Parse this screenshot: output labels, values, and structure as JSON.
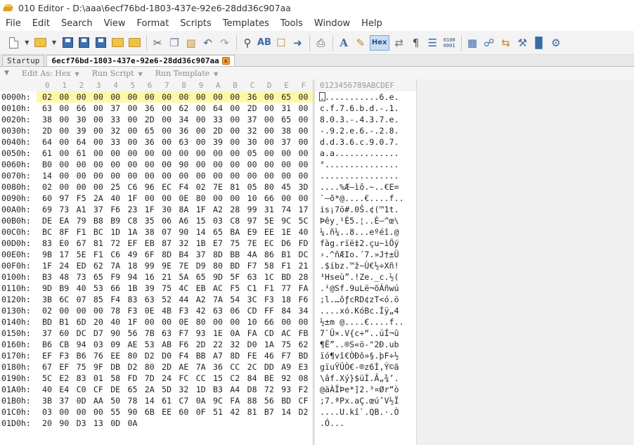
{
  "window": {
    "title": "010 Editor - D:\\aaa\\6ecf76bd-1803-437e-92e6-28dd36c907aa"
  },
  "menu": [
    "File",
    "Edit",
    "Search",
    "View",
    "Format",
    "Scripts",
    "Templates",
    "Tools",
    "Window",
    "Help"
  ],
  "toolbar": {
    "hex_label": "Hex",
    "bits_label_top": "0100",
    "bits_label_bottom": "0001"
  },
  "tabs": [
    {
      "label": "Startup",
      "active": false
    },
    {
      "label": "6ecf76bd-1803-437e-92e6-28dd36c907aa",
      "active": true,
      "close": "x"
    }
  ],
  "subbar": {
    "edit_as": "Edit As: Hex",
    "run_script": "Run Script",
    "run_template": "Run Template"
  },
  "columns": {
    "hex": [
      "0",
      "1",
      "2",
      "3",
      "4",
      "5",
      "6",
      "7",
      "8",
      "9",
      "A",
      "B",
      "C",
      "D",
      "E",
      "F"
    ],
    "ascii": "0123456789ABCDEF"
  },
  "rows": [
    {
      "addr": "0000h:",
      "hex": [
        "02",
        "00",
        "00",
        "00",
        "00",
        "00",
        "00",
        "00",
        "00",
        "00",
        "00",
        "00",
        "36",
        "00",
        "65",
        "00"
      ],
      "ascii": "............6.e."
    },
    {
      "addr": "0010h:",
      "hex": [
        "63",
        "00",
        "66",
        "00",
        "37",
        "00",
        "36",
        "00",
        "62",
        "00",
        "64",
        "00",
        "2D",
        "00",
        "31",
        "00"
      ],
      "ascii": "c.f.7.6.b.d.-.1."
    },
    {
      "addr": "0020h:",
      "hex": [
        "38",
        "00",
        "30",
        "00",
        "33",
        "00",
        "2D",
        "00",
        "34",
        "00",
        "33",
        "00",
        "37",
        "00",
        "65",
        "00"
      ],
      "ascii": "8.0.3.-.4.3.7.e."
    },
    {
      "addr": "0030h:",
      "hex": [
        "2D",
        "00",
        "39",
        "00",
        "32",
        "00",
        "65",
        "00",
        "36",
        "00",
        "2D",
        "00",
        "32",
        "00",
        "38",
        "00"
      ],
      "ascii": "-.9.2.e.6.-.2.8."
    },
    {
      "addr": "0040h:",
      "hex": [
        "64",
        "00",
        "64",
        "00",
        "33",
        "00",
        "36",
        "00",
        "63",
        "00",
        "39",
        "00",
        "30",
        "00",
        "37",
        "00"
      ],
      "ascii": "d.d.3.6.c.9.0.7."
    },
    {
      "addr": "0050h:",
      "hex": [
        "61",
        "00",
        "61",
        "00",
        "00",
        "00",
        "00",
        "00",
        "00",
        "00",
        "00",
        "00",
        "05",
        "00",
        "00",
        "00"
      ],
      "ascii": "a.a............."
    },
    {
      "addr": "0060h:",
      "hex": [
        "B0",
        "00",
        "00",
        "00",
        "00",
        "00",
        "00",
        "00",
        "90",
        "00",
        "00",
        "00",
        "00",
        "00",
        "00",
        "00"
      ],
      "ascii": "°..............."
    },
    {
      "addr": "0070h:",
      "hex": [
        "14",
        "00",
        "00",
        "00",
        "00",
        "00",
        "00",
        "00",
        "00",
        "00",
        "00",
        "00",
        "00",
        "00",
        "00",
        "00"
      ],
      "ascii": "................"
    },
    {
      "addr": "0080h:",
      "hex": [
        "02",
        "00",
        "00",
        "00",
        "25",
        "C6",
        "96",
        "EC",
        "F4",
        "02",
        "7E",
        "81",
        "05",
        "80",
        "45",
        "3D"
      ],
      "ascii": "....%Æ–ìô.~..€E="
    },
    {
      "addr": "0090h:",
      "hex": [
        "60",
        "97",
        "F5",
        "2A",
        "40",
        "1F",
        "00",
        "00",
        "0E",
        "80",
        "00",
        "00",
        "10",
        "66",
        "00",
        "00"
      ],
      "ascii": "`—õ*@....€....f.."
    },
    {
      "addr": "00A0h:",
      "hex": [
        "69",
        "73",
        "A1",
        "37",
        "F6",
        "23",
        "1F",
        "30",
        "8A",
        "1F",
        "A2",
        "28",
        "99",
        "31",
        "74",
        "17"
      ],
      "ascii": "is¡7ö#.0Š.¢(™1t."
    },
    {
      "addr": "00B0h:",
      "hex": [
        "DE",
        "EA",
        "79",
        "B8",
        "B9",
        "C8",
        "35",
        "06",
        "A6",
        "15",
        "03",
        "C8",
        "97",
        "5E",
        "9C",
        "5C"
      ],
      "ascii": "Þêy¸¹È5.¦..È—^œ\\"
    },
    {
      "addr": "00C0h:",
      "hex": [
        "BC",
        "8F",
        "F1",
        "BC",
        "1D",
        "1A",
        "38",
        "07",
        "90",
        "14",
        "65",
        "BA",
        "E9",
        "EE",
        "1E",
        "40"
      ],
      "ascii": "¼.ñ¼..8...eºéî.@"
    },
    {
      "addr": "00D0h:",
      "hex": [
        "83",
        "E0",
        "67",
        "81",
        "72",
        "EF",
        "EB",
        "87",
        "32",
        "1B",
        "E7",
        "75",
        "7E",
        "EC",
        "D6",
        "FD"
      ],
      "ascii": "fàg.rïë‡2.çu~ìÖý"
    },
    {
      "addr": "00E0h:",
      "hex": [
        "9B",
        "17",
        "5E",
        "F1",
        "C6",
        "49",
        "6F",
        "8D",
        "B4",
        "37",
        "8D",
        "BB",
        "4A",
        "86",
        "B1",
        "DC"
      ],
      "ascii": "›.^ñÆIo.´7.»J†±Ü"
    },
    {
      "addr": "00F0h:",
      "hex": [
        "1F",
        "24",
        "ED",
        "62",
        "7A",
        "18",
        "99",
        "9E",
        "7E",
        "D9",
        "80",
        "BD",
        "F7",
        "58",
        "F1",
        "21"
      ],
      "ascii": ".$íbz.™ž~Ù€½÷Xñ!"
    },
    {
      "addr": "0100h:",
      "hex": [
        "B3",
        "48",
        "73",
        "65",
        "F9",
        "94",
        "16",
        "21",
        "5A",
        "65",
        "9D",
        "5F",
        "63",
        "1C",
        "BD",
        "28"
      ],
      "ascii": "³Hseù”.!Ze._c.½("
    },
    {
      "addr": "0110h:",
      "hex": [
        "9D",
        "B9",
        "40",
        "53",
        "66",
        "1B",
        "39",
        "75",
        "4C",
        "EB",
        "AC",
        "F5",
        "C1",
        "F1",
        "77",
        "FA"
      ],
      "ascii": ".¹@Sf.9uLë¬õÁñwú"
    },
    {
      "addr": "0120h:",
      "hex": [
        "3B",
        "6C",
        "07",
        "85",
        "F4",
        "83",
        "63",
        "52",
        "44",
        "A2",
        "7A",
        "54",
        "3C",
        "F3",
        "18",
        "F6"
      ],
      "ascii": ";l.…ôƒcRD¢zT<ó.ö"
    },
    {
      "addr": "0130h:",
      "hex": [
        "02",
        "00",
        "00",
        "00",
        "78",
        "F3",
        "0E",
        "4B",
        "F3",
        "42",
        "63",
        "06",
        "CD",
        "FF",
        "84",
        "34"
      ],
      "ascii": "....xó.KóBc.Íÿ„4"
    },
    {
      "addr": "0140h:",
      "hex": [
        "BD",
        "B1",
        "6D",
        "20",
        "40",
        "1F",
        "00",
        "00",
        "0E",
        "80",
        "00",
        "00",
        "10",
        "66",
        "00",
        "00"
      ],
      "ascii": "½±m @....€....f.."
    },
    {
      "addr": "0150h:",
      "hex": [
        "37",
        "60",
        "DC",
        "D7",
        "90",
        "56",
        "7B",
        "63",
        "F7",
        "93",
        "1E",
        "0A",
        "FA",
        "CD",
        "AC",
        "FB"
      ],
      "ascii": "7`Ü×.V{c÷“..úÍ¬û"
    },
    {
      "addr": "0160h:",
      "hex": [
        "B6",
        "CB",
        "94",
        "03",
        "09",
        "AE",
        "53",
        "AB",
        "F6",
        "2D",
        "22",
        "32",
        "D0",
        "1A",
        "75",
        "62"
      ],
      "ascii": "¶Ë”..®S«ö-\"2Ð.ub"
    },
    {
      "addr": "0170h:",
      "hex": [
        "EF",
        "F3",
        "B6",
        "76",
        "EE",
        "80",
        "D2",
        "D0",
        "F4",
        "BB",
        "A7",
        "8D",
        "FE",
        "46",
        "F7",
        "BD"
      ],
      "ascii": "ïó¶vî€ÒÐô»§.þF÷½"
    },
    {
      "addr": "0180h:",
      "hex": [
        "67",
        "EF",
        "75",
        "9F",
        "DB",
        "D2",
        "80",
        "2D",
        "AE",
        "7A",
        "36",
        "CC",
        "2C",
        "DD",
        "A9",
        "E3"
      ],
      "ascii": "gïuŸÛÒ€-®z6Ì,Ý©ã"
    },
    {
      "addr": "0190h:",
      "hex": [
        "5C",
        "E2",
        "83",
        "01",
        "58",
        "FD",
        "7D",
        "24",
        "FC",
        "CC",
        "15",
        "C2",
        "84",
        "BE",
        "92",
        "08"
      ],
      "ascii": "\\âf.Xý}$üÌ.Â„¾’."
    },
    {
      "addr": "01A0h:",
      "hex": [
        "40",
        "E4",
        "C0",
        "CF",
        "DE",
        "65",
        "2A",
        "5D",
        "32",
        "1D",
        "B3",
        "A4",
        "D8",
        "72",
        "93",
        "F2"
      ],
      "ascii": "@äÀÏÞe*]2.³¤Ør“ò"
    },
    {
      "addr": "01B0h:",
      "hex": [
        "3B",
        "37",
        "0D",
        "AA",
        "50",
        "78",
        "14",
        "61",
        "C7",
        "0A",
        "9C",
        "FA",
        "88",
        "56",
        "BD",
        "CF"
      ],
      "ascii": ";7.ªPx.aÇ.œúˆV½Ï"
    },
    {
      "addr": "01C0h:",
      "hex": [
        "03",
        "00",
        "00",
        "00",
        "55",
        "90",
        "6B",
        "EE",
        "60",
        "0F",
        "51",
        "42",
        "81",
        "B7",
        "14",
        "D2"
      ],
      "ascii": "....U.kî`.QB.·.Ò"
    },
    {
      "addr": "01D0h:",
      "hex": [
        "20",
        "90",
        "D3",
        "13",
        "0D",
        "0A"
      ],
      "ascii": " .Ó..."
    }
  ],
  "colors": {
    "highlight_row": "#fff7a8",
    "accent": "#3a6aa8"
  }
}
